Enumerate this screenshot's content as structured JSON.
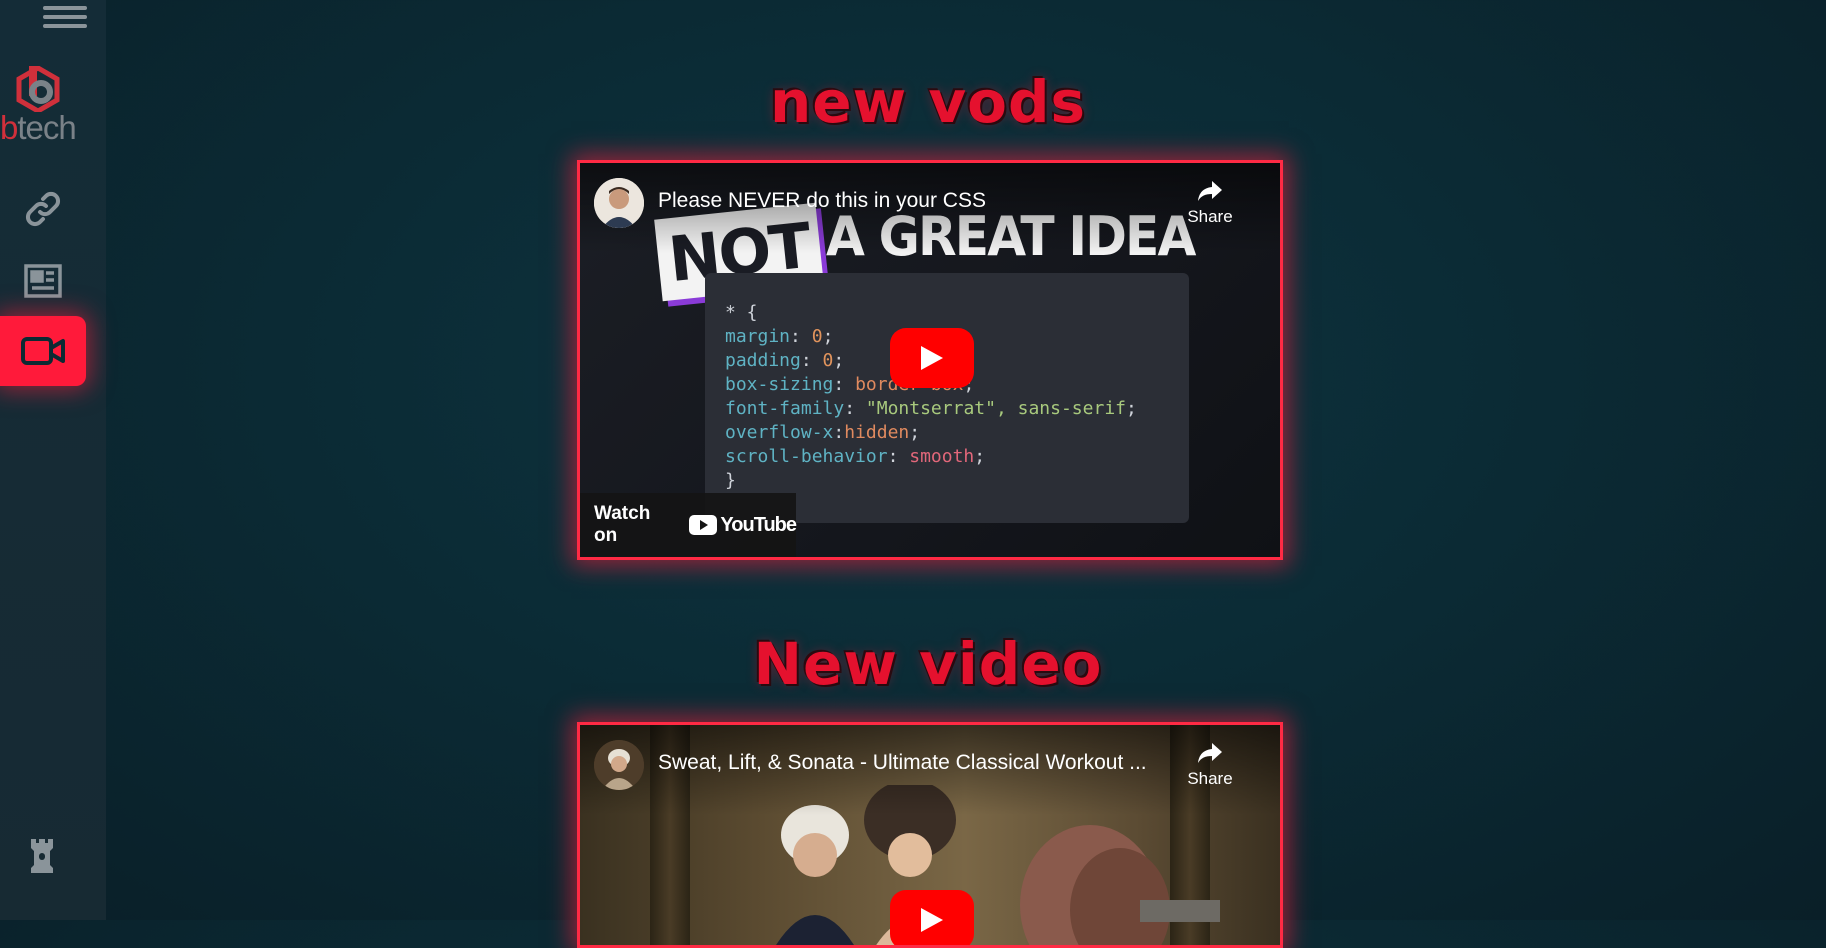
{
  "sidebar": {
    "menu_label": "menu",
    "logo": {
      "brand_first": "b",
      "brand_rest": "tech",
      "accent": "#d0303b"
    },
    "items": [
      {
        "name": "links",
        "icon": "link-icon",
        "active": false
      },
      {
        "name": "news",
        "icon": "newspaper-icon",
        "active": false
      },
      {
        "name": "videos",
        "icon": "video-camera-icon",
        "active": true
      }
    ],
    "bottom_item": {
      "icon": "rook-icon"
    }
  },
  "sections": [
    {
      "title": "new vods",
      "video": {
        "title": "Please NEVER do this in your CSS",
        "share_label": "Share",
        "watch_on_label": "Watch on",
        "youtube_word": "YouTube",
        "thumbnail": {
          "badge_text": "NOT",
          "headline": "A GREAT IDEA",
          "code": {
            "open": "* {",
            "lines": [
              {
                "prop": "margin",
                "value": "0",
                "kind": "num"
              },
              {
                "prop": "padding",
                "value": "0",
                "kind": "num"
              },
              {
                "prop": "box-sizing",
                "value": "border-box",
                "kind": "kw"
              },
              {
                "prop": "font-family",
                "value": "\"Montserrat\", sans-serif",
                "kind": "str"
              },
              {
                "prop": "overflow-x",
                "value": "hidden",
                "kind": "kw"
              },
              {
                "prop": "scroll-behavior",
                "value": "smooth",
                "kind": "red"
              }
            ],
            "close": "}"
          }
        }
      }
    },
    {
      "title": "New video",
      "video": {
        "title": "Sweat, Lift, & Sonata - Ultimate Classical Workout ...",
        "share_label": "Share"
      }
    }
  ],
  "colors": {
    "accent": "#ff1a3a",
    "title_red": "#e5112e",
    "background": "#0b2b35"
  }
}
